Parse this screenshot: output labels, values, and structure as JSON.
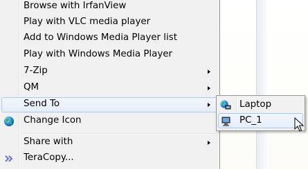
{
  "menu": {
    "items": [
      {
        "label": "Browse with IrfanView",
        "has_submenu": false
      },
      {
        "label": "Play with VLC media player",
        "has_submenu": false
      },
      {
        "label": "Add to Windows Media Player list",
        "has_submenu": false
      },
      {
        "label": "Play with Windows Media Player",
        "has_submenu": false
      },
      {
        "label": "7-Zip",
        "has_submenu": true
      },
      {
        "label": "QM",
        "has_submenu": true
      },
      {
        "label": "Send To",
        "has_submenu": true,
        "highlighted": true
      },
      {
        "label": "Change Icon",
        "has_submenu": false,
        "icon": "globe-icon"
      },
      {
        "label": "Share with",
        "has_submenu": true
      },
      {
        "label": "TeraCopy...",
        "has_submenu": false,
        "icon": "double-chevron-icon"
      }
    ]
  },
  "submenu": {
    "items": [
      {
        "label": "Laptop",
        "icon": "network-globe-icon"
      },
      {
        "label": "PC_1",
        "icon": "network-computer-icon",
        "highlighted": true
      }
    ]
  },
  "colors": {
    "menu_bg": "#f1f1f1",
    "highlight_border": "#a8c8ec",
    "highlight_bg": "#e6eefa"
  }
}
